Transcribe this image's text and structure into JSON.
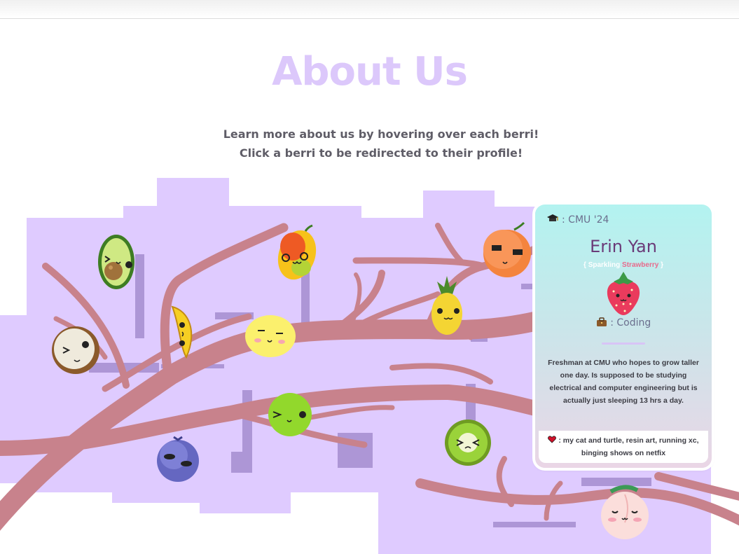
{
  "page": {
    "title": "About Us",
    "subtitle_line1": "Learn more about us by hovering over each berri!",
    "subtitle_line2": "Click a berri to be redirected to their profile!"
  },
  "colors": {
    "title": "#dcc8fb",
    "background_shape": "#dfcbff",
    "branch": "#c8828c",
    "accent_pink": "#e86a8c"
  },
  "fruits": [
    "avocado",
    "mango",
    "orange",
    "banana",
    "lemon",
    "pineapple",
    "coconut",
    "lime",
    "kiwi",
    "blueberry",
    "peach"
  ],
  "profile_card": {
    "school_icon": "graduation-cap-icon",
    "school": ": CMU '24",
    "name": "Erin Yan",
    "berri_open": "{ Sparkling ",
    "berri_name": "Strawberry",
    "berri_close": " }",
    "hobby_icon": "briefcase-icon",
    "hobby": ": Coding",
    "description": "Freshman at CMU who hopes to grow taller one day. Is supposed to be studying electrical and computer engineering but is actually just sleeping 13 hrs a day.",
    "likes_icon": "heart-icon",
    "likes": ": my cat and turtle, resin art, running xc, binging shows on netfix"
  }
}
